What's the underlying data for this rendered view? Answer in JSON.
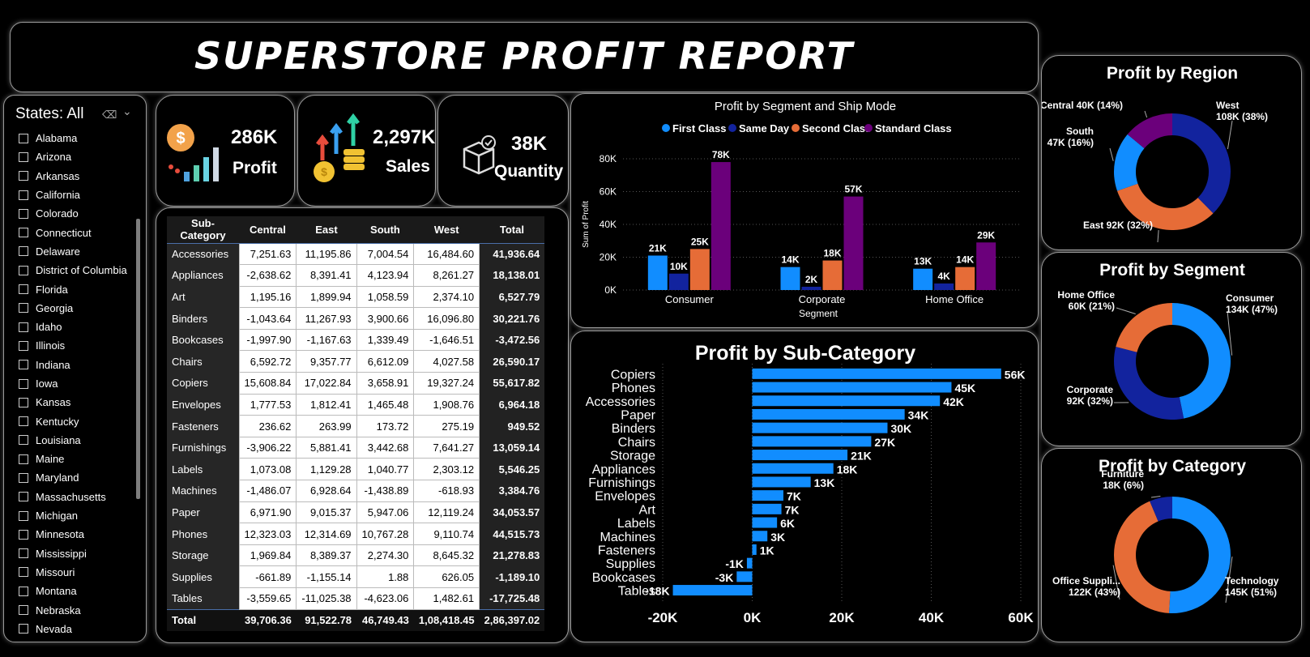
{
  "report_title": "SUPERSTORE PROFIT REPORT",
  "slicer": {
    "label": "States: All",
    "states": [
      "Alabama",
      "Arizona",
      "Arkansas",
      "California",
      "Colorado",
      "Connecticut",
      "Delaware",
      "District of Columbia",
      "Florida",
      "Georgia",
      "Idaho",
      "Illinois",
      "Indiana",
      "Iowa",
      "Kansas",
      "Kentucky",
      "Louisiana",
      "Maine",
      "Maryland",
      "Massachusetts",
      "Michigan",
      "Minnesota",
      "Mississippi",
      "Missouri",
      "Montana",
      "Nebraska",
      "Nevada"
    ]
  },
  "kpis": {
    "profit": {
      "value": "286K",
      "label": "Profit"
    },
    "sales": {
      "value": "2,297K",
      "label": "Sales"
    },
    "quantity": {
      "value": "38K",
      "label": "Quantity"
    }
  },
  "matrix": {
    "headers": [
      "Sub-Category",
      "Central",
      "East",
      "South",
      "West",
      "Total"
    ],
    "rows": [
      [
        "Accessories",
        "7,251.63",
        "11,195.86",
        "7,004.54",
        "16,484.60",
        "41,936.64"
      ],
      [
        "Appliances",
        "-2,638.62",
        "8,391.41",
        "4,123.94",
        "8,261.27",
        "18,138.01"
      ],
      [
        "Art",
        "1,195.16",
        "1,899.94",
        "1,058.59",
        "2,374.10",
        "6,527.79"
      ],
      [
        "Binders",
        "-1,043.64",
        "11,267.93",
        "3,900.66",
        "16,096.80",
        "30,221.76"
      ],
      [
        "Bookcases",
        "-1,997.90",
        "-1,167.63",
        "1,339.49",
        "-1,646.51",
        "-3,472.56"
      ],
      [
        "Chairs",
        "6,592.72",
        "9,357.77",
        "6,612.09",
        "4,027.58",
        "26,590.17"
      ],
      [
        "Copiers",
        "15,608.84",
        "17,022.84",
        "3,658.91",
        "19,327.24",
        "55,617.82"
      ],
      [
        "Envelopes",
        "1,777.53",
        "1,812.41",
        "1,465.48",
        "1,908.76",
        "6,964.18"
      ],
      [
        "Fasteners",
        "236.62",
        "263.99",
        "173.72",
        "275.19",
        "949.52"
      ],
      [
        "Furnishings",
        "-3,906.22",
        "5,881.41",
        "3,442.68",
        "7,641.27",
        "13,059.14"
      ],
      [
        "Labels",
        "1,073.08",
        "1,129.28",
        "1,040.77",
        "2,303.12",
        "5,546.25"
      ],
      [
        "Machines",
        "-1,486.07",
        "6,928.64",
        "-1,438.89",
        "-618.93",
        "3,384.76"
      ],
      [
        "Paper",
        "6,971.90",
        "9,015.37",
        "5,947.06",
        "12,119.24",
        "34,053.57"
      ],
      [
        "Phones",
        "12,323.03",
        "12,314.69",
        "10,767.28",
        "9,110.74",
        "44,515.73"
      ],
      [
        "Storage",
        "1,969.84",
        "8,389.37",
        "2,274.30",
        "8,645.32",
        "21,278.83"
      ],
      [
        "Supplies",
        "-661.89",
        "-1,155.14",
        "1.88",
        "626.05",
        "-1,189.10"
      ],
      [
        "Tables",
        "-3,559.65",
        "-11,025.38",
        "-4,623.06",
        "1,482.61",
        "-17,725.48"
      ]
    ],
    "total": [
      "Total",
      "39,706.36",
      "91,522.78",
      "46,749.43",
      "1,08,418.45",
      "2,86,397.02"
    ]
  },
  "chart_data": [
    {
      "type": "bar",
      "title": "Profit by Segment and Ship Mode",
      "xlabel": "Segment",
      "ylabel": "Sum of Profit",
      "categories": [
        "Consumer",
        "Corporate",
        "Home Office"
      ],
      "ylim": [
        0,
        80000
      ],
      "yticks": [
        "0K",
        "20K",
        "40K",
        "60K",
        "80K"
      ],
      "legend_position": "top",
      "series": [
        {
          "name": "First Class",
          "color": "#118dff",
          "values": [
            21000,
            14000,
            13000
          ],
          "labels": [
            "21K",
            "14K",
            "13K"
          ]
        },
        {
          "name": "Same Day",
          "color": "#12239e",
          "values": [
            10000,
            2000,
            4000
          ],
          "labels": [
            "10K",
            "2K",
            "4K"
          ]
        },
        {
          "name": "Second Class",
          "color": "#e66c37",
          "values": [
            25000,
            18000,
            14000
          ],
          "labels": [
            "25K",
            "18K",
            "14K"
          ]
        },
        {
          "name": "Standard Class",
          "color": "#6b007b",
          "values": [
            78000,
            57000,
            29000
          ],
          "labels": [
            "78K",
            "57K",
            "29K"
          ]
        }
      ]
    },
    {
      "type": "bar",
      "orientation": "horizontal",
      "title": "Profit by Sub-Category",
      "color": "#118dff",
      "xlim": [
        -20000,
        60000
      ],
      "xticks": [
        "-20K",
        "0K",
        "20K",
        "40K",
        "60K"
      ],
      "categories": [
        "Copiers",
        "Phones",
        "Accessories",
        "Paper",
        "Binders",
        "Chairs",
        "Storage",
        "Appliances",
        "Furnishings",
        "Envelopes",
        "Art",
        "Labels",
        "Machines",
        "Fasteners",
        "Supplies",
        "Bookcases",
        "Tables"
      ],
      "values": [
        55617.82,
        44515.73,
        41936.64,
        34053.57,
        30221.76,
        26590.17,
        21278.83,
        18138.01,
        13059.14,
        6964.18,
        6527.79,
        5546.25,
        3384.76,
        949.52,
        -1189.1,
        -3472.56,
        -17725.48
      ],
      "labels": [
        "56K",
        "45K",
        "42K",
        "34K",
        "30K",
        "27K",
        "21K",
        "18K",
        "13K",
        "7K",
        "7K",
        "6K",
        "3K",
        "1K",
        "-1K",
        "-3K",
        "-18K"
      ]
    },
    {
      "type": "pie",
      "title": "Profit by Region",
      "categories": [
        "West",
        "East",
        "South",
        "Central"
      ],
      "values": [
        108000,
        92000,
        47000,
        40000
      ],
      "colors": [
        "#12239e",
        "#e66c37",
        "#118dff",
        "#6b007b"
      ],
      "labels": [
        "West\n108K (38%)",
        "East 92K (32%)",
        "South\n47K (16%)",
        "Central 40K (14%)"
      ]
    },
    {
      "type": "pie",
      "title": "Profit by Segment",
      "categories": [
        "Consumer",
        "Corporate",
        "Home Office"
      ],
      "values": [
        134000,
        92000,
        60000
      ],
      "colors": [
        "#118dff",
        "#12239e",
        "#e66c37"
      ],
      "labels": [
        "Consumer\n134K (47%)",
        "Corporate\n92K (32%)",
        "Home Office\n60K (21%)"
      ]
    },
    {
      "type": "pie",
      "title": "Profit by Category",
      "categories": [
        "Technology",
        "Office Supplies",
        "Furniture"
      ],
      "values": [
        145000,
        122000,
        18000
      ],
      "colors": [
        "#118dff",
        "#e66c37",
        "#12239e"
      ],
      "labels": [
        "Technology\n145K (51%)",
        "Office Suppli...\n122K (43%)",
        "Furniture\n18K (6%)"
      ]
    }
  ]
}
